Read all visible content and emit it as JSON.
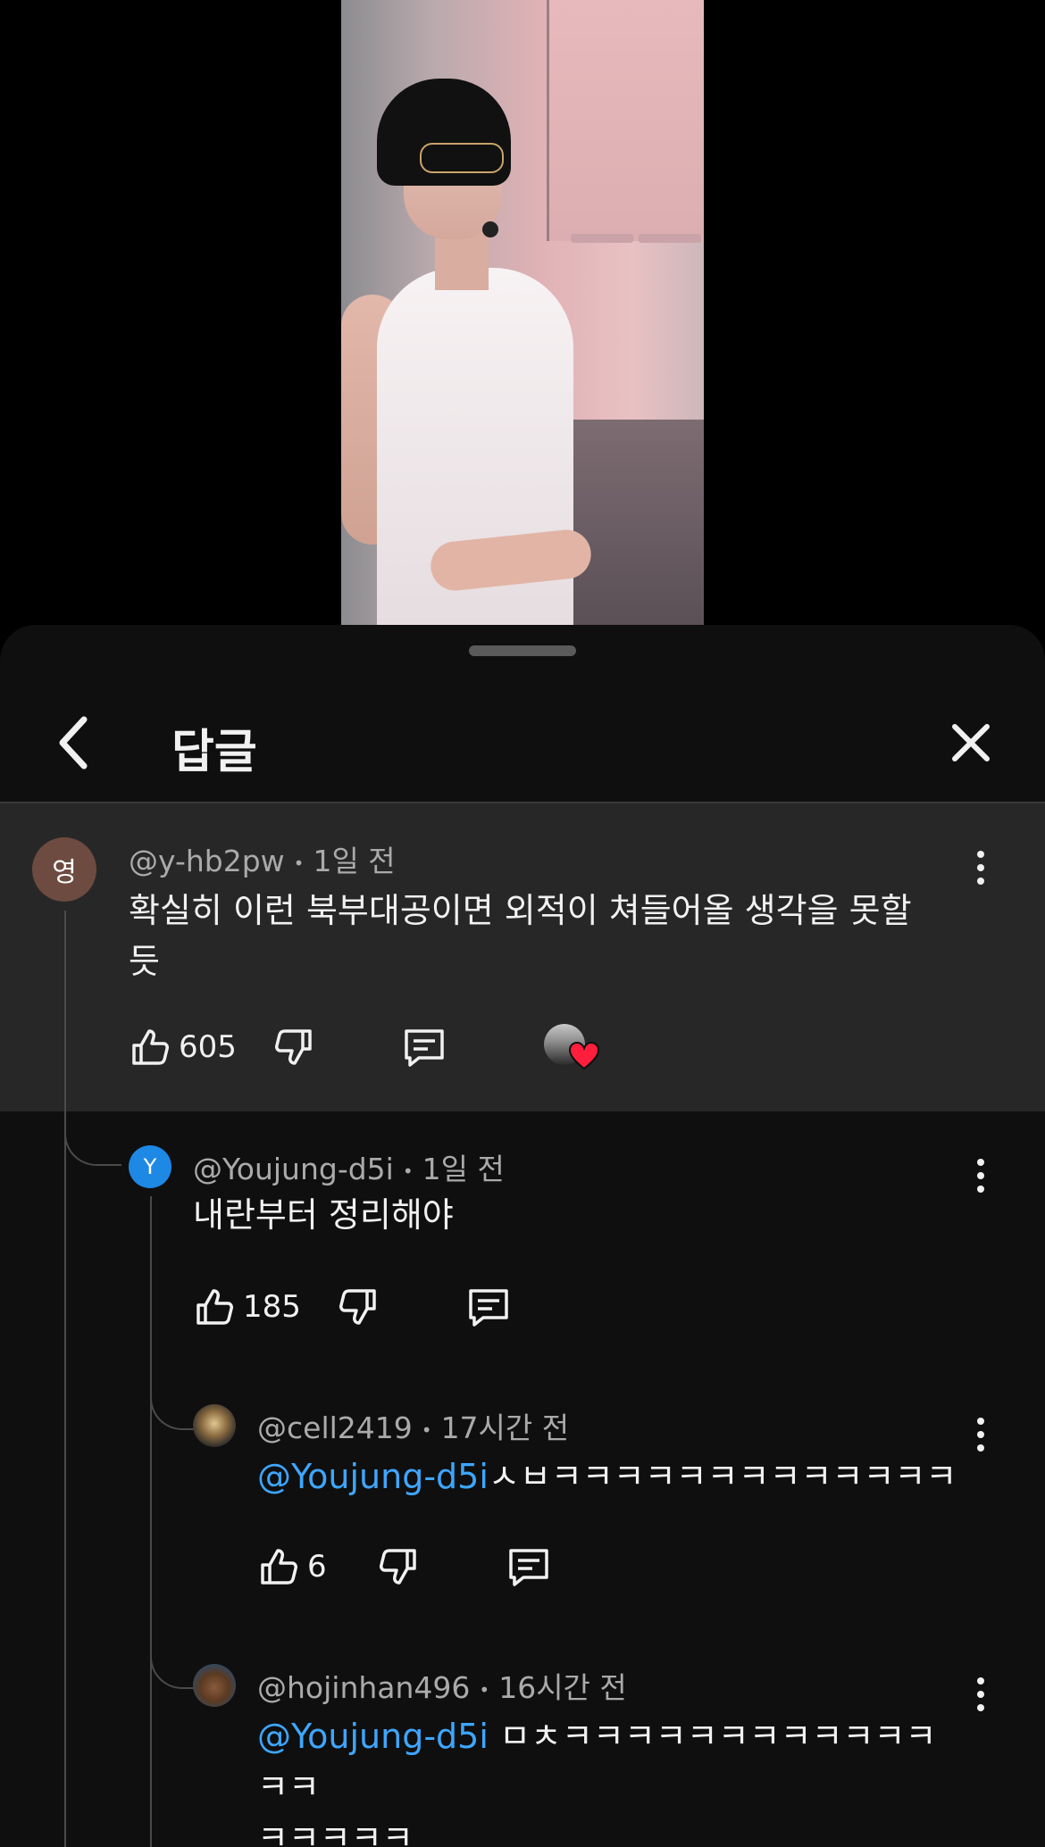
{
  "header": {
    "title": "답글"
  },
  "comments": [
    {
      "avatar_initial": "영",
      "avatar_color": "#6d4b40",
      "author": "@y-hb2pw",
      "time": "1일 전",
      "text_line1": "확실히 이런 북부대공이면 외적이 쳐들어올 생각을 못할",
      "text_line2": "듯",
      "likes": "605",
      "creator_heart": true
    },
    {
      "avatar_initial": "Y",
      "avatar_color": "#1e88e5",
      "author": "@Youjung-d5i",
      "time": "1일 전",
      "text": "내란부터 정리해야",
      "likes": "185"
    },
    {
      "author": "@cell2419",
      "time": "17시간 전",
      "mention": "@Youjung-d5i",
      "text": "ㅅㅂㅋㅋㅋㅋㅋㅋㅋㅋㅋㅋㅋㅋㅋ",
      "likes": "6"
    },
    {
      "author": "@hojinhan496",
      "time": "16시간 전",
      "mention": "@Youjung-d5i",
      "text_line1": " ㅁㅊㅋㅋㅋㅋㅋㅋㅋㅋㅋㅋㅋㅋㅋㅋ",
      "text_line2": "ㅋㅋㅋㅋㅋ"
    }
  ],
  "icons": {
    "back": "chevron-left-icon",
    "close": "close-icon",
    "like": "thumb-up-icon",
    "dislike": "thumb-down-icon",
    "reply": "reply-comment-icon",
    "more": "more-vertical-icon"
  }
}
